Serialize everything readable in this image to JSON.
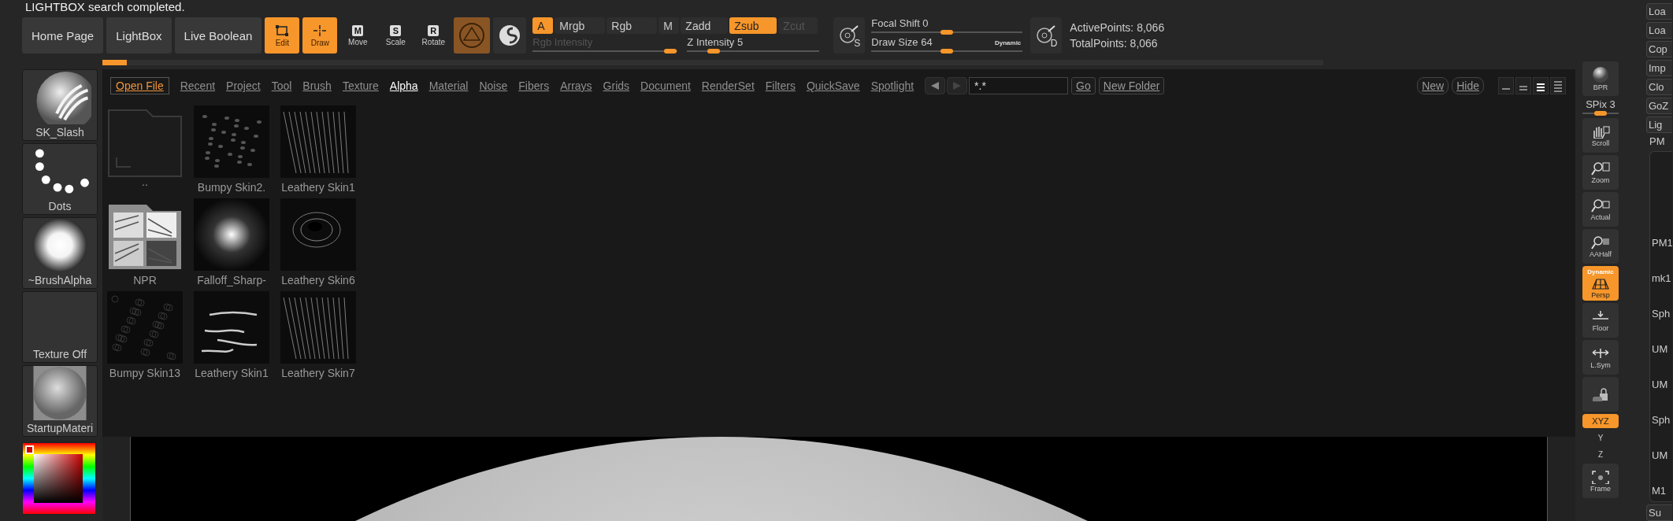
{
  "status_message": "LIGHTBOX search completed.",
  "nav_buttons": [
    {
      "label": "Home Page"
    },
    {
      "label": "LightBox"
    },
    {
      "label": "Live Boolean"
    }
  ],
  "transform_tools": [
    {
      "label": "Edit",
      "kind": "edit",
      "on": true
    },
    {
      "label": "Draw",
      "kind": "draw",
      "on": true
    },
    {
      "label": "Move",
      "kind": "lettered",
      "glyph": "M",
      "on": false
    },
    {
      "label": "Scale",
      "kind": "lettered",
      "glyph": "S",
      "on": false
    },
    {
      "label": "Rotate",
      "kind": "lettered",
      "glyph": "R",
      "on": false
    }
  ],
  "modes": [
    {
      "label": "A",
      "on": true,
      "disabled": false
    },
    {
      "label": "Mrgb",
      "on": false,
      "disabled": false
    },
    {
      "label": "Rgb",
      "on": false,
      "disabled": false
    },
    {
      "label": "M",
      "on": false,
      "disabled": false
    },
    {
      "label": "Zadd",
      "on": false,
      "disabled": false
    },
    {
      "label": "Zsub",
      "on": true,
      "disabled": false
    },
    {
      "label": "Zcut",
      "on": false,
      "disabled": true
    }
  ],
  "intensity_sliders": [
    {
      "label": "Rgb Intensity",
      "disabled": true,
      "level": 0.95
    },
    {
      "label": "Z Intensity 5",
      "disabled": false,
      "level": 0.2
    }
  ],
  "stroke_panel": {
    "icon_letter": "S",
    "sliders": [
      {
        "label": "Focal Shift 0",
        "level": 0.5
      },
      {
        "label": "Draw Size 64",
        "level": 0.5
      }
    ],
    "dynamic_label": "Dynamic"
  },
  "points_panel": {
    "icon_letter": "D",
    "lines": [
      "ActivePoints: 8,066",
      "TotalPoints: 8,066"
    ]
  },
  "progress": {
    "level": 0.02
  },
  "palette": [
    {
      "label": "SK_Slash",
      "kind": "slash"
    },
    {
      "label": "Dots",
      "kind": "dots"
    },
    {
      "label": "~BrushAlpha",
      "kind": "glow"
    },
    {
      "label": "Texture Off",
      "kind": "empty"
    },
    {
      "label": "StartupMateri",
      "kind": "sphere"
    }
  ],
  "lightbox": {
    "open_file_label": "Open File",
    "tabs": [
      {
        "label": "Recent",
        "selected": false
      },
      {
        "label": "Project",
        "selected": false
      },
      {
        "label": "Tool",
        "selected": false
      },
      {
        "label": "Brush",
        "selected": false
      },
      {
        "label": "Texture",
        "selected": false
      },
      {
        "label": "Alpha",
        "selected": true
      },
      {
        "label": "Material",
        "selected": false
      },
      {
        "label": "Noise",
        "selected": false
      },
      {
        "label": "Fibers",
        "selected": false
      },
      {
        "label": "Arrays",
        "selected": false
      },
      {
        "label": "Grids",
        "selected": false
      },
      {
        "label": "Document",
        "selected": false
      },
      {
        "label": "RenderSet",
        "selected": false
      },
      {
        "label": "Filters",
        "selected": false
      },
      {
        "label": "QuickSave",
        "selected": false
      },
      {
        "label": "Spotlight",
        "selected": false
      }
    ],
    "search": {
      "value": "*.*"
    },
    "go_label": "Go",
    "new_folder_label": "New Folder",
    "right_buttons": [
      "New",
      "Hide"
    ],
    "views": [
      {
        "selected": false
      },
      {
        "selected": false
      },
      {
        "selected": true
      },
      {
        "selected": false
      }
    ],
    "items": [
      {
        "label": "..",
        "kind": "folder-up"
      },
      {
        "label": "Bumpy Skin2.",
        "kind": "spots"
      },
      {
        "label": "Leathery Skin1",
        "kind": "scratches"
      },
      {
        "label": "NPR",
        "kind": "folder"
      },
      {
        "label": "Falloff_Sharp-",
        "kind": "glow"
      },
      {
        "label": "Leathery Skin6",
        "kind": "swirl"
      },
      {
        "label": "Bumpy Skin13",
        "kind": "cells"
      },
      {
        "label": "Leathery Skin1",
        "kind": "streaks"
      },
      {
        "label": "Leathery Skin7",
        "kind": "scratches"
      }
    ]
  },
  "shelf": [
    {
      "label": "BPR",
      "kind": "bpr",
      "on": false
    },
    {
      "label": "SPix 3",
      "kind": "slider",
      "level": 0.5
    },
    {
      "label": "Scroll",
      "kind": "scroll",
      "on": false
    },
    {
      "label": "Zoom",
      "kind": "zoom",
      "on": false
    },
    {
      "label": "Actual",
      "kind": "actual",
      "on": false
    },
    {
      "label": "AAHalf",
      "kind": "aahalf",
      "on": false
    },
    {
      "label": "Persp",
      "kind": "persp",
      "badge": "Dynamic",
      "on": true
    },
    {
      "label": "Floor",
      "kind": "floor",
      "on": false
    },
    {
      "label": "L.Sym",
      "kind": "lsym",
      "on": false
    },
    {
      "kind": "lock",
      "on": false
    },
    {
      "label": "XYZ",
      "kind": "pill",
      "on": true
    },
    {
      "label": "Y",
      "kind": "mini"
    },
    {
      "label": "Z",
      "kind": "mini"
    },
    {
      "label": "Frame",
      "kind": "frame",
      "on": false
    }
  ],
  "right_panel": {
    "buttons": [
      "Loa",
      "Loa",
      "Cop",
      "Imp",
      "Clo",
      "GoZ",
      "Lig"
    ],
    "label": "PM",
    "tools": [
      "PM1",
      "mk1",
      "Sph",
      "UM",
      "UM",
      "Sph",
      "UM",
      "M1"
    ],
    "bottom_button": "Su"
  }
}
